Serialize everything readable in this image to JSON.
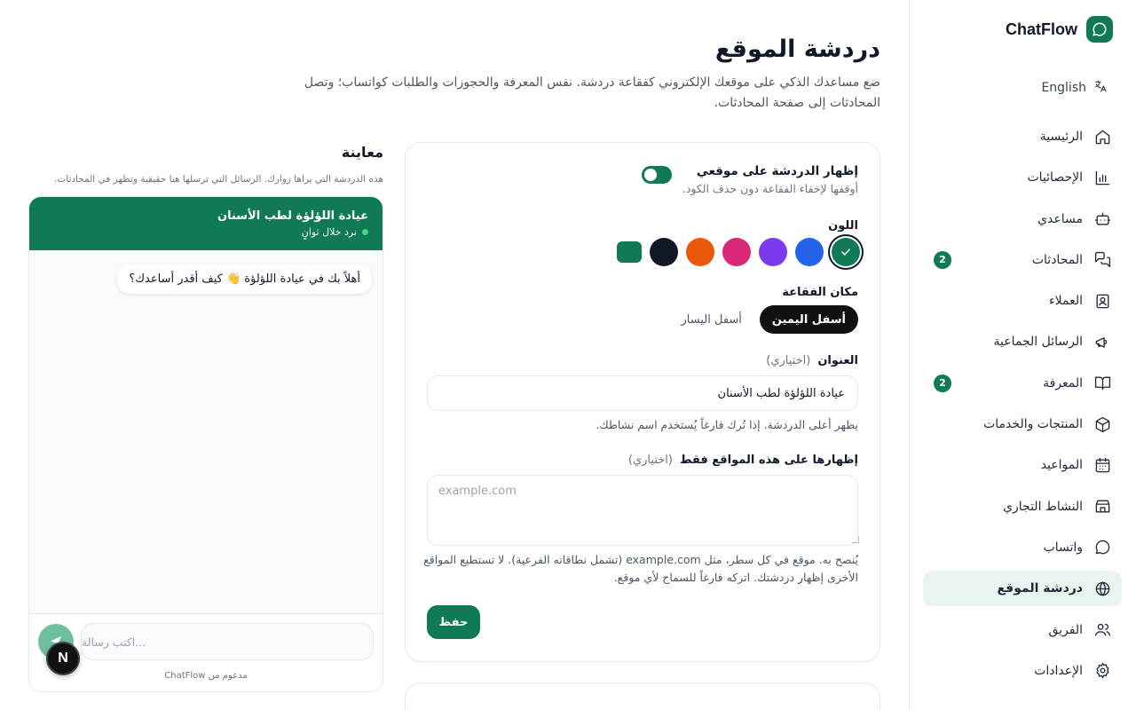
{
  "brand": {
    "name": "ChatFlow",
    "icon": "chat-bubble-icon"
  },
  "language": {
    "label": "English",
    "icon": "translate-icon"
  },
  "sidebar": {
    "items": [
      {
        "label": "الرئيسية",
        "icon": "home-icon",
        "badge": null,
        "active": false
      },
      {
        "label": "الإحصائيات",
        "icon": "bar-chart-icon",
        "badge": null,
        "active": false
      },
      {
        "label": "مساعدي",
        "icon": "bot-icon",
        "badge": null,
        "active": false
      },
      {
        "label": "المحادثات",
        "icon": "messages-icon",
        "badge": "2",
        "active": false
      },
      {
        "label": "العملاء",
        "icon": "contact-card-icon",
        "badge": null,
        "active": false
      },
      {
        "label": "الرسائل الجماعية",
        "icon": "megaphone-icon",
        "badge": null,
        "active": false
      },
      {
        "label": "المعرفة",
        "icon": "book-icon",
        "badge": "2",
        "active": false
      },
      {
        "label": "المنتجات والخدمات",
        "icon": "package-icon",
        "badge": null,
        "active": false
      },
      {
        "label": "المواعيد",
        "icon": "calendar-icon",
        "badge": null,
        "active": false
      },
      {
        "label": "النشاط التجاري",
        "icon": "store-icon",
        "badge": null,
        "active": false
      },
      {
        "label": "واتساب",
        "icon": "whatsapp-icon",
        "badge": null,
        "active": false
      },
      {
        "label": "دردشة الموقع",
        "icon": "globe-icon",
        "badge": null,
        "active": true
      },
      {
        "label": "الفريق",
        "icon": "users-icon",
        "badge": null,
        "active": false
      },
      {
        "label": "الإعدادات",
        "icon": "gear-icon",
        "badge": null,
        "active": false
      }
    ]
  },
  "page": {
    "title": "دردشة الموقع",
    "description": "ضع مساعدك الذكي على موقعك الإلكتروني كفقاعة دردشة. نفس المعرفة والحجوزات والطلبات كواتساب؛ وتصل المحادثات إلى صفحة المحادثات."
  },
  "settings": {
    "toggle_title": "إظهار الدردشة على موقعي",
    "toggle_sub": "أوقفها لإخفاء الفقاعة دون حذف الكود.",
    "toggle_on": true,
    "color_label": "اللون",
    "colors": [
      "#0f7a55",
      "#2563eb",
      "#7c3aed",
      "#db2777",
      "#ea580c",
      "#111827",
      "#0f7a55"
    ],
    "selected_color": "#0f7a55",
    "position_label": "مكان الفقاعة",
    "position_options": [
      "أسفل اليمين",
      "أسفل اليسار"
    ],
    "position_selected": "أسفل اليمين",
    "title_label": "العنوان",
    "optional": "(اختياري)",
    "title_value": "عيادة اللؤلؤة لطب الأسنان",
    "title_help": "يظهر أعلى الدردشة. إذا تُرك فارغاً يُستخدم اسم نشاطك.",
    "domains_label": "إظهارها على هذه المواقع فقط",
    "domains_placeholder": "example.com",
    "domains_help": "يُنصح به. موقع في كل سطر، مثل example.com (تشمل نطاقاته الفرعية). لا تستطيع المواقع الأخرى إظهار دردشتك. اتركه فارغاً للسماح لأي موقع.",
    "save_label": "حفظ"
  },
  "preview": {
    "title": "معاينة",
    "subtitle": "هذه الدردشة التي يراها زوارك. الرسائل التي ترسلها هنا حقيقية وتظهر في المحادثات.",
    "header_title": "عيادة اللؤلؤة لطب الأسنان",
    "status": "نرد خلال ثوانٍ",
    "greeting": "أهلاً بك في عيادة اللؤلؤة 👋 كيف أقدر أساعدك؟",
    "input_placeholder": "...اكتب رسالة",
    "powered_by": "مدعوم من ChatFlow",
    "floating_badge": "N"
  }
}
